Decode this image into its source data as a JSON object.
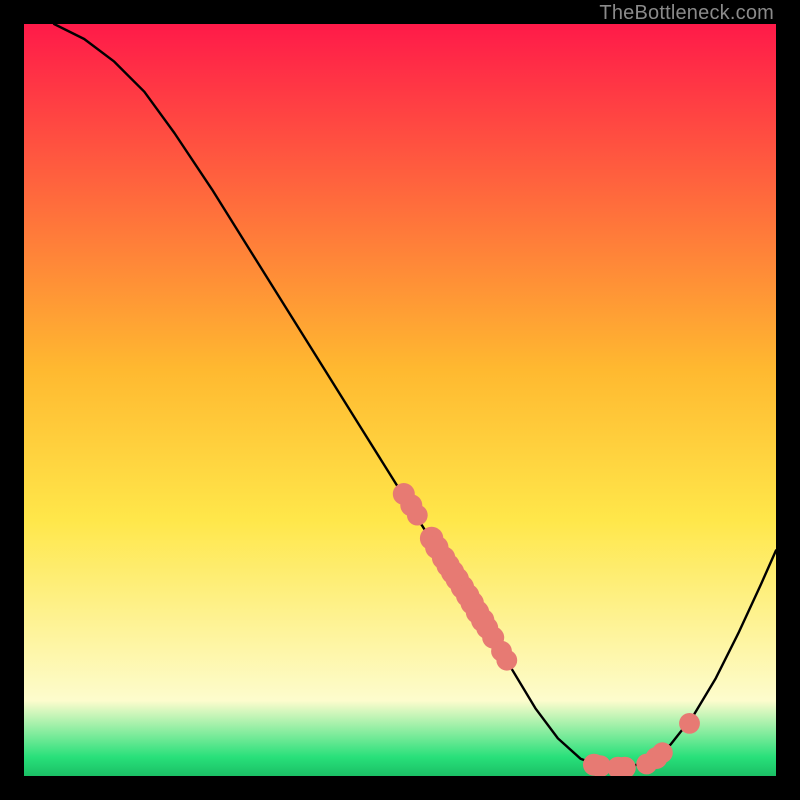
{
  "watermark": "TheBottleneck.com",
  "colors": {
    "curve_stroke": "#000000",
    "dot_fill": "#e77a73",
    "gradient_top": "#ff1a49",
    "gradient_upper_mid": "#ffb930",
    "gradient_mid": "#ffe74a",
    "gradient_low": "#fdfccd",
    "gradient_green": "#28e07a",
    "frame_bg": "#000000"
  },
  "chart_data": {
    "type": "line",
    "title": "",
    "xlabel": "",
    "ylabel": "",
    "xlim": [
      0,
      100
    ],
    "ylim": [
      0,
      100
    ],
    "grid": false,
    "curve": [
      {
        "x": 4,
        "y": 100
      },
      {
        "x": 8,
        "y": 98
      },
      {
        "x": 12,
        "y": 95
      },
      {
        "x": 16,
        "y": 91
      },
      {
        "x": 20,
        "y": 85.5
      },
      {
        "x": 25,
        "y": 78
      },
      {
        "x": 30,
        "y": 70
      },
      {
        "x": 35,
        "y": 62
      },
      {
        "x": 40,
        "y": 54
      },
      {
        "x": 45,
        "y": 46
      },
      {
        "x": 50,
        "y": 38
      },
      {
        "x": 55,
        "y": 30
      },
      {
        "x": 60,
        "y": 22
      },
      {
        "x": 65,
        "y": 14
      },
      {
        "x": 68,
        "y": 9
      },
      {
        "x": 71,
        "y": 5
      },
      {
        "x": 74,
        "y": 2.3
      },
      {
        "x": 77,
        "y": 1.2
      },
      {
        "x": 80,
        "y": 1.2
      },
      {
        "x": 83,
        "y": 1.8
      },
      {
        "x": 86,
        "y": 4.2
      },
      {
        "x": 89,
        "y": 8
      },
      {
        "x": 92,
        "y": 13
      },
      {
        "x": 95,
        "y": 19
      },
      {
        "x": 98,
        "y": 25.5
      },
      {
        "x": 100,
        "y": 30
      }
    ],
    "dots": [
      {
        "x": 50.5,
        "y": 37.5,
        "r": 1.1
      },
      {
        "x": 51.5,
        "y": 36.0,
        "r": 1.1
      },
      {
        "x": 52.3,
        "y": 34.7,
        "r": 1.0
      },
      {
        "x": 54.2,
        "y": 31.6,
        "r": 1.2
      },
      {
        "x": 54.9,
        "y": 30.4,
        "r": 1.2
      },
      {
        "x": 55.8,
        "y": 29.0,
        "r": 1.2
      },
      {
        "x": 56.4,
        "y": 28.0,
        "r": 1.2
      },
      {
        "x": 57.0,
        "y": 27.1,
        "r": 1.2
      },
      {
        "x": 57.6,
        "y": 26.2,
        "r": 1.2
      },
      {
        "x": 58.3,
        "y": 25.1,
        "r": 1.2
      },
      {
        "x": 59.0,
        "y": 24.0,
        "r": 1.2
      },
      {
        "x": 59.6,
        "y": 23.0,
        "r": 1.2
      },
      {
        "x": 60.3,
        "y": 21.8,
        "r": 1.2
      },
      {
        "x": 61.0,
        "y": 20.7,
        "r": 1.2
      },
      {
        "x": 61.6,
        "y": 19.7,
        "r": 1.1
      },
      {
        "x": 62.4,
        "y": 18.4,
        "r": 1.1
      },
      {
        "x": 63.5,
        "y": 16.6,
        "r": 1.0
      },
      {
        "x": 64.2,
        "y": 15.4,
        "r": 1.0
      },
      {
        "x": 75.8,
        "y": 1.5,
        "r": 1.1
      },
      {
        "x": 76.6,
        "y": 1.3,
        "r": 1.1
      },
      {
        "x": 79.0,
        "y": 1.1,
        "r": 1.1
      },
      {
        "x": 79.9,
        "y": 1.1,
        "r": 1.1
      },
      {
        "x": 82.8,
        "y": 1.6,
        "r": 1.0
      },
      {
        "x": 84.1,
        "y": 2.4,
        "r": 1.1
      },
      {
        "x": 84.9,
        "y": 3.1,
        "r": 1.0
      },
      {
        "x": 88.5,
        "y": 7.0,
        "r": 1.0
      }
    ]
  }
}
